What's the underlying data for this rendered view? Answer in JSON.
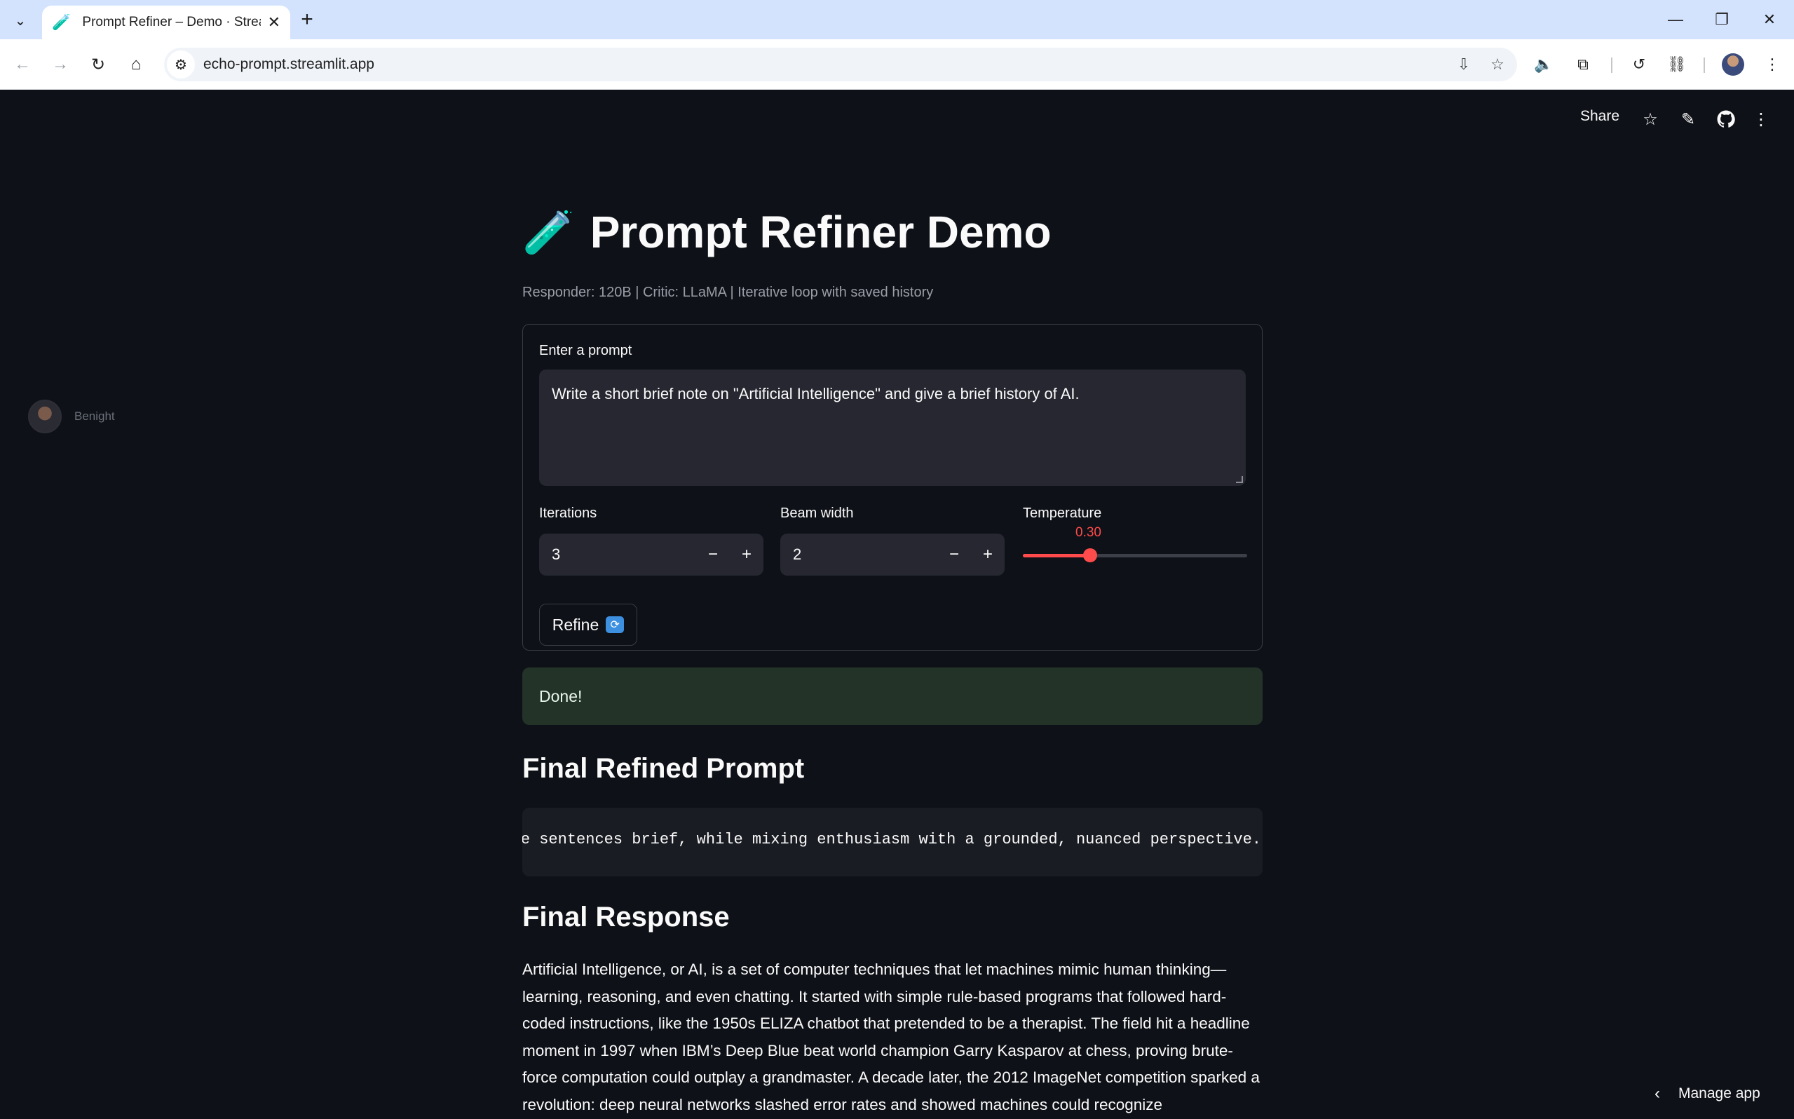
{
  "browser": {
    "tab_title": "Prompt Refiner – Demo · Stream",
    "tab_favicon": "🧪",
    "new_tab": "+",
    "url": "echo-prompt.streamlit.app"
  },
  "app_header": {
    "share_label": "Share"
  },
  "sidebar_user": {
    "name": "Benight"
  },
  "page": {
    "title_emoji": "🧪",
    "title": "Prompt Refiner Demo",
    "caption": "Responder: 120B | Critic: LLaMA | Iterative loop with saved history"
  },
  "form": {
    "prompt_label": "Enter a prompt",
    "prompt_value": "Write a short brief note on \"Artificial Intelligence\" and give a brief history of AI.",
    "iterations_label": "Iterations",
    "iterations_value": "3",
    "beam_label": "Beam width",
    "beam_value": "2",
    "temperature_label": "Temperature",
    "temperature_value": "0.30",
    "temperature_fraction": 0.3,
    "refine_label": "Refine",
    "refine_icon": "🔄"
  },
  "status": {
    "message": "Done!"
  },
  "final_prompt": {
    "heading": "Final Refined Prompt",
    "code_visible": "d the sentences brief, while mixing enthusiasm with a grounded, nuanced perspective."
  },
  "final_response": {
    "heading": "Final Response",
    "text": "Artificial Intelligence, or AI, is a set of computer techniques that let machines mimic human thinking—learning, reasoning, and even chatting. It started with simple rule-based programs that followed hard-coded instructions, like the 1950s ELIZA chatbot that pretended to be a therapist. The field hit a headline moment in 1997 when IBM’s Deep Blue beat world champion Garry Kasparov at chess, proving brute-force computation could outplay a grandmaster. A decade later, the 2012 ImageNet competition sparked a revolution: deep neural networks slashed error rates and showed machines could recognize"
  },
  "footer": {
    "manage_label": "Manage app"
  },
  "colors": {
    "app_bg": "#0e1117",
    "accent": "#ff4b4b",
    "success_bg": "#233327",
    "input_bg": "#262730",
    "tabbar_bg": "#d3e3fd"
  }
}
